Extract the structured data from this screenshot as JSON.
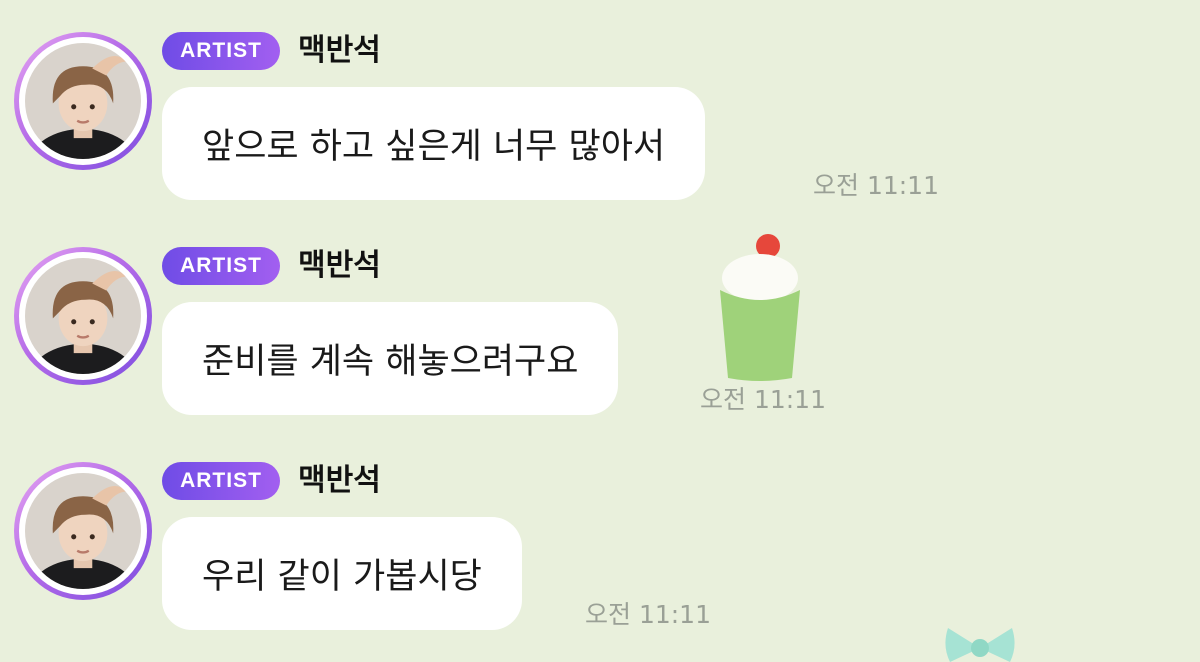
{
  "chat": {
    "messages": [
      {
        "badge": "ARTIST",
        "sender": "맥반석",
        "text": "앞으로 하고 싶은게 너무 많아서",
        "time": "오전 11:11"
      },
      {
        "badge": "ARTIST",
        "sender": "맥반석",
        "text": "준비를 계속 해놓으려구요",
        "time": "오전 11:11"
      },
      {
        "badge": "ARTIST",
        "sender": "맥반석",
        "text": "우리 같이 가봅시당",
        "time": "오전 11:11"
      }
    ]
  },
  "theme": {
    "background": "#e9f0dc",
    "bubble": "#ffffff",
    "badge_gradient_start": "#6f4ce6",
    "badge_gradient_end": "#a25ff0",
    "avatar_ring": "#b46be8",
    "timestamp": "#9aa096"
  },
  "icons": {
    "decor_1": "cupcake-sticker-icon",
    "decor_2": "bow-sticker-icon"
  }
}
